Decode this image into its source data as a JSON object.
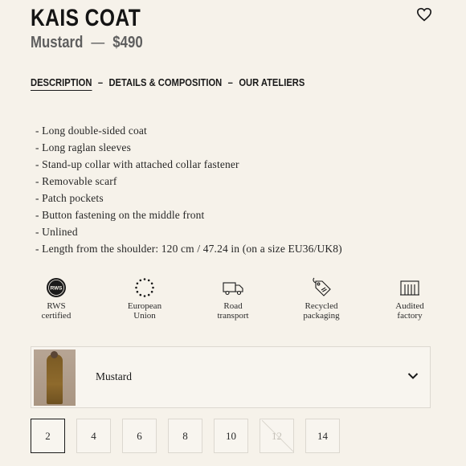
{
  "product": {
    "title": "KAIS COAT",
    "color": "Mustard",
    "dash": "—",
    "price": "$490"
  },
  "tabs": [
    {
      "label": "DESCRIPTION",
      "active": true
    },
    {
      "label": "DETAILS & COMPOSITION",
      "active": false
    },
    {
      "label": "OUR ATELIERS",
      "active": false
    }
  ],
  "tab_separator": "–",
  "description": [
    "- Long double-sided coat",
    "- Long raglan sleeves",
    "- Stand-up collar with attached collar fastener",
    "- Removable scarf",
    "- Patch pockets",
    "- Button fastening on the middle front",
    "- Unlined",
    "- Length from the shoulder: 120 cm / 47.24 in (on a size EU36/UK8)"
  ],
  "badges": [
    {
      "icon": "rws-icon",
      "line1": "RWS",
      "line2": "certified"
    },
    {
      "icon": "european-union-icon",
      "line1": "European",
      "line2": "Union"
    },
    {
      "icon": "truck-icon",
      "line1": "Road",
      "line2": "transport"
    },
    {
      "icon": "tag-icon",
      "line1": "Recycled",
      "line2": "packaging"
    },
    {
      "icon": "factory-icon",
      "line1": "Audited",
      "line2": "factory"
    }
  ],
  "rws_badge_text": "RWS",
  "color_select": {
    "selected": "Mustard"
  },
  "sizes": [
    {
      "label": "2",
      "state": "selected"
    },
    {
      "label": "4",
      "state": "available"
    },
    {
      "label": "6",
      "state": "available"
    },
    {
      "label": "8",
      "state": "available"
    },
    {
      "label": "10",
      "state": "available"
    },
    {
      "label": "12",
      "state": "unavailable"
    },
    {
      "label": "14",
      "state": "available"
    }
  ],
  "colors": {
    "background": "#f6f2ea",
    "text": "#1a1a1a",
    "muted": "#5e5e5e",
    "border": "#dcd8d0",
    "mustard": "#8e6a2c"
  }
}
